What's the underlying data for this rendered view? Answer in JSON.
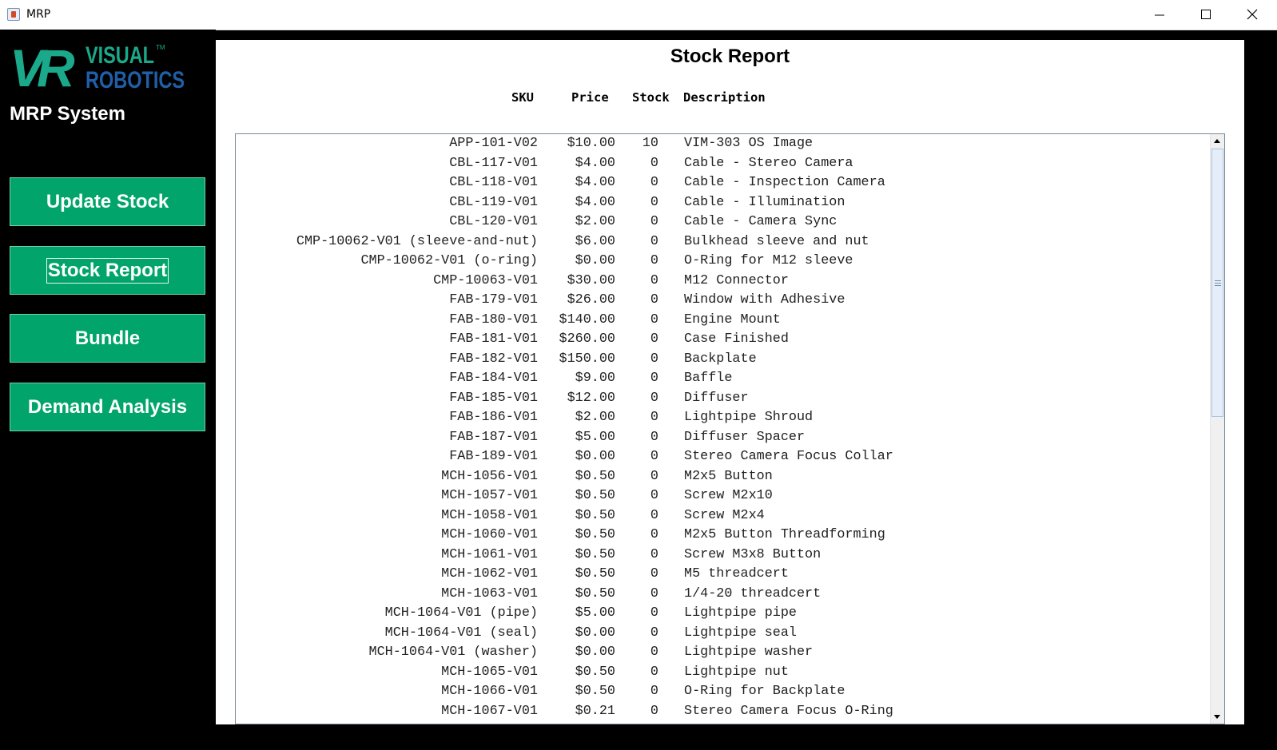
{
  "window": {
    "title": "MRP"
  },
  "sidebar": {
    "logo_top": "VISUAL",
    "logo_bottom": "ROBOTICS",
    "logo_tm": "TM",
    "logo_mark": "VR",
    "system_title": "MRP System",
    "buttons": [
      "Update Stock",
      "Stock Report",
      "Bundle",
      "Demand Analysis"
    ]
  },
  "colors": {
    "button_green": "#01a56c",
    "logo_teal": "#1aa98a",
    "logo_blue": "#1f5fa8"
  },
  "report": {
    "title": "Stock Report",
    "headers": {
      "sku": "SKU",
      "price": "Price",
      "stock": "Stock",
      "description": "Description"
    },
    "rows": [
      [
        "APP-101-V02",
        "$10.00",
        "10",
        "VIM-303 OS Image"
      ],
      [
        "CBL-117-V01",
        "$4.00",
        "0",
        "Cable - Stereo Camera"
      ],
      [
        "CBL-118-V01",
        "$4.00",
        "0",
        "Cable - Inspection Camera"
      ],
      [
        "CBL-119-V01",
        "$4.00",
        "0",
        "Cable - Illumination"
      ],
      [
        "CBL-120-V01",
        "$2.00",
        "0",
        "Cable - Camera Sync"
      ],
      [
        "CMP-10062-V01 (sleeve-and-nut)",
        "$6.00",
        "0",
        "Bulkhead sleeve and nut"
      ],
      [
        "CMP-10062-V01 (o-ring)",
        "$0.00",
        "0",
        "O-Ring for M12 sleeve"
      ],
      [
        "CMP-10063-V01",
        "$30.00",
        "0",
        "M12 Connector"
      ],
      [
        "FAB-179-V01",
        "$26.00",
        "0",
        "Window with Adhesive"
      ],
      [
        "FAB-180-V01",
        "$140.00",
        "0",
        "Engine Mount"
      ],
      [
        "FAB-181-V01",
        "$260.00",
        "0",
        "Case Finished"
      ],
      [
        "FAB-182-V01",
        "$150.00",
        "0",
        "Backplate"
      ],
      [
        "FAB-184-V01",
        "$9.00",
        "0",
        "Baffle"
      ],
      [
        "FAB-185-V01",
        "$12.00",
        "0",
        "Diffuser"
      ],
      [
        "FAB-186-V01",
        "$2.00",
        "0",
        "Lightpipe Shroud"
      ],
      [
        "FAB-187-V01",
        "$5.00",
        "0",
        "Diffuser Spacer"
      ],
      [
        "FAB-189-V01",
        "$0.00",
        "0",
        "Stereo Camera Focus Collar"
      ],
      [
        "MCH-1056-V01",
        "$0.50",
        "0",
        "M2x5 Button"
      ],
      [
        "MCH-1057-V01",
        "$0.50",
        "0",
        "Screw M2x10"
      ],
      [
        "MCH-1058-V01",
        "$0.50",
        "0",
        "Screw M2x4"
      ],
      [
        "MCH-1060-V01",
        "$0.50",
        "0",
        "M2x5 Button Threadforming"
      ],
      [
        "MCH-1061-V01",
        "$0.50",
        "0",
        "Screw M3x8 Button"
      ],
      [
        "MCH-1062-V01",
        "$0.50",
        "0",
        "M5 threadcert"
      ],
      [
        "MCH-1063-V01",
        "$0.50",
        "0",
        "1/4-20 threadcert"
      ],
      [
        "MCH-1064-V01 (pipe)",
        "$5.00",
        "0",
        "Lightpipe pipe"
      ],
      [
        "MCH-1064-V01 (seal)",
        "$0.00",
        "0",
        "Lightpipe seal"
      ],
      [
        "MCH-1064-V01 (washer)",
        "$0.00",
        "0",
        "Lightpipe washer"
      ],
      [
        "MCH-1065-V01",
        "$0.50",
        "0",
        "Lightpipe nut"
      ],
      [
        "MCH-1066-V01",
        "$0.50",
        "0",
        "O-Ring for Backplate"
      ],
      [
        "MCH-1067-V01",
        "$0.21",
        "0",
        "Stereo Camera Focus O-Ring"
      ]
    ]
  }
}
